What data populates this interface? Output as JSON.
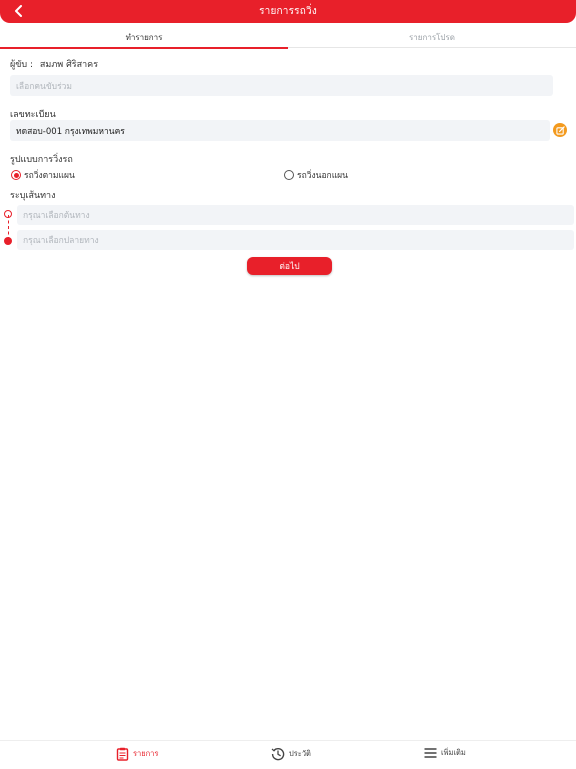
{
  "header": {
    "title": "รายการรถวิ่ง",
    "back_icon": "chevron-left-icon"
  },
  "tabs": [
    {
      "label": "ทำรายการ",
      "active": true
    },
    {
      "label": "รายการโปรด",
      "active": false
    }
  ],
  "driver": {
    "label": "ผู้ขับ :",
    "name": "สมภพ  ศิริสาคร"
  },
  "co_driver": {
    "placeholder": "เลือกคนขับร่วม"
  },
  "registration": {
    "label": "เลขทะเบียน",
    "value": "ทดสอบ-001 กรุงเทพมหานคร",
    "edit_icon": "edit-icon"
  },
  "run_type": {
    "label": "รูปแบบการวิ่งรถ",
    "options": [
      {
        "label": "รถวิ่งตามแผน",
        "selected": true
      },
      {
        "label": "รถวิ่งนอกแผน",
        "selected": false
      }
    ]
  },
  "route": {
    "label": "ระบุเส้นทาง",
    "origin_placeholder": "กรุณาเลือกต้นทาง",
    "destination_placeholder": "กรุณาเลือกปลายทาง"
  },
  "next_button": "ต่อไป",
  "bottom_nav": [
    {
      "label": "รายการ",
      "icon": "clipboard-icon",
      "active": true
    },
    {
      "label": "ประวัติ",
      "icon": "history-icon",
      "active": false
    },
    {
      "label": "เพิ่มเติม",
      "icon": "menu-icon",
      "active": false
    }
  ],
  "colors": {
    "accent": "#e8202a",
    "edit": "#f39a1e",
    "field_bg": "#f2f4f7"
  }
}
